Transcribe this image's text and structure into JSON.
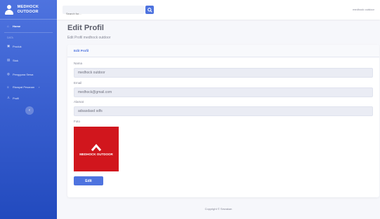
{
  "sidebar": {
    "brand": "MEDHOCK OUTDOOR",
    "home": "Home",
    "heading": "DATA",
    "items": [
      {
        "label": "Produk",
        "icon": "box-icon"
      },
      {
        "label": "Stok",
        "icon": "layers-icon"
      },
      {
        "label": "Pengguna Sewa",
        "icon": "users-icon"
      },
      {
        "label": "Riwayat Pesanan",
        "icon": "receipt-icon"
      },
      {
        "label": "Profil",
        "icon": "user-icon"
      }
    ],
    "toggle_symbol": "‹"
  },
  "topbar": {
    "search_placeholder": "Search for...",
    "user_name": "medhock outdoor"
  },
  "page": {
    "title": "Edit Profil",
    "subtitle": "Edit Profil medhock outdoor"
  },
  "card": {
    "header": "Edit Profil",
    "fields": [
      {
        "label": "Nama",
        "value": "medhock outdoor"
      },
      {
        "label": "Email",
        "value": "medhock@gmail.com"
      },
      {
        "label": "Alamat",
        "value": "adsasdasd sdfs"
      }
    ],
    "photo_label": "Foto",
    "logo_text": "MEDHOCK OUTDOOR",
    "edit_label": "Edit"
  },
  "footer": "Copyright © Sewakan",
  "colors": {
    "accent": "#4e73df",
    "logo_bg": "#d1161d"
  }
}
